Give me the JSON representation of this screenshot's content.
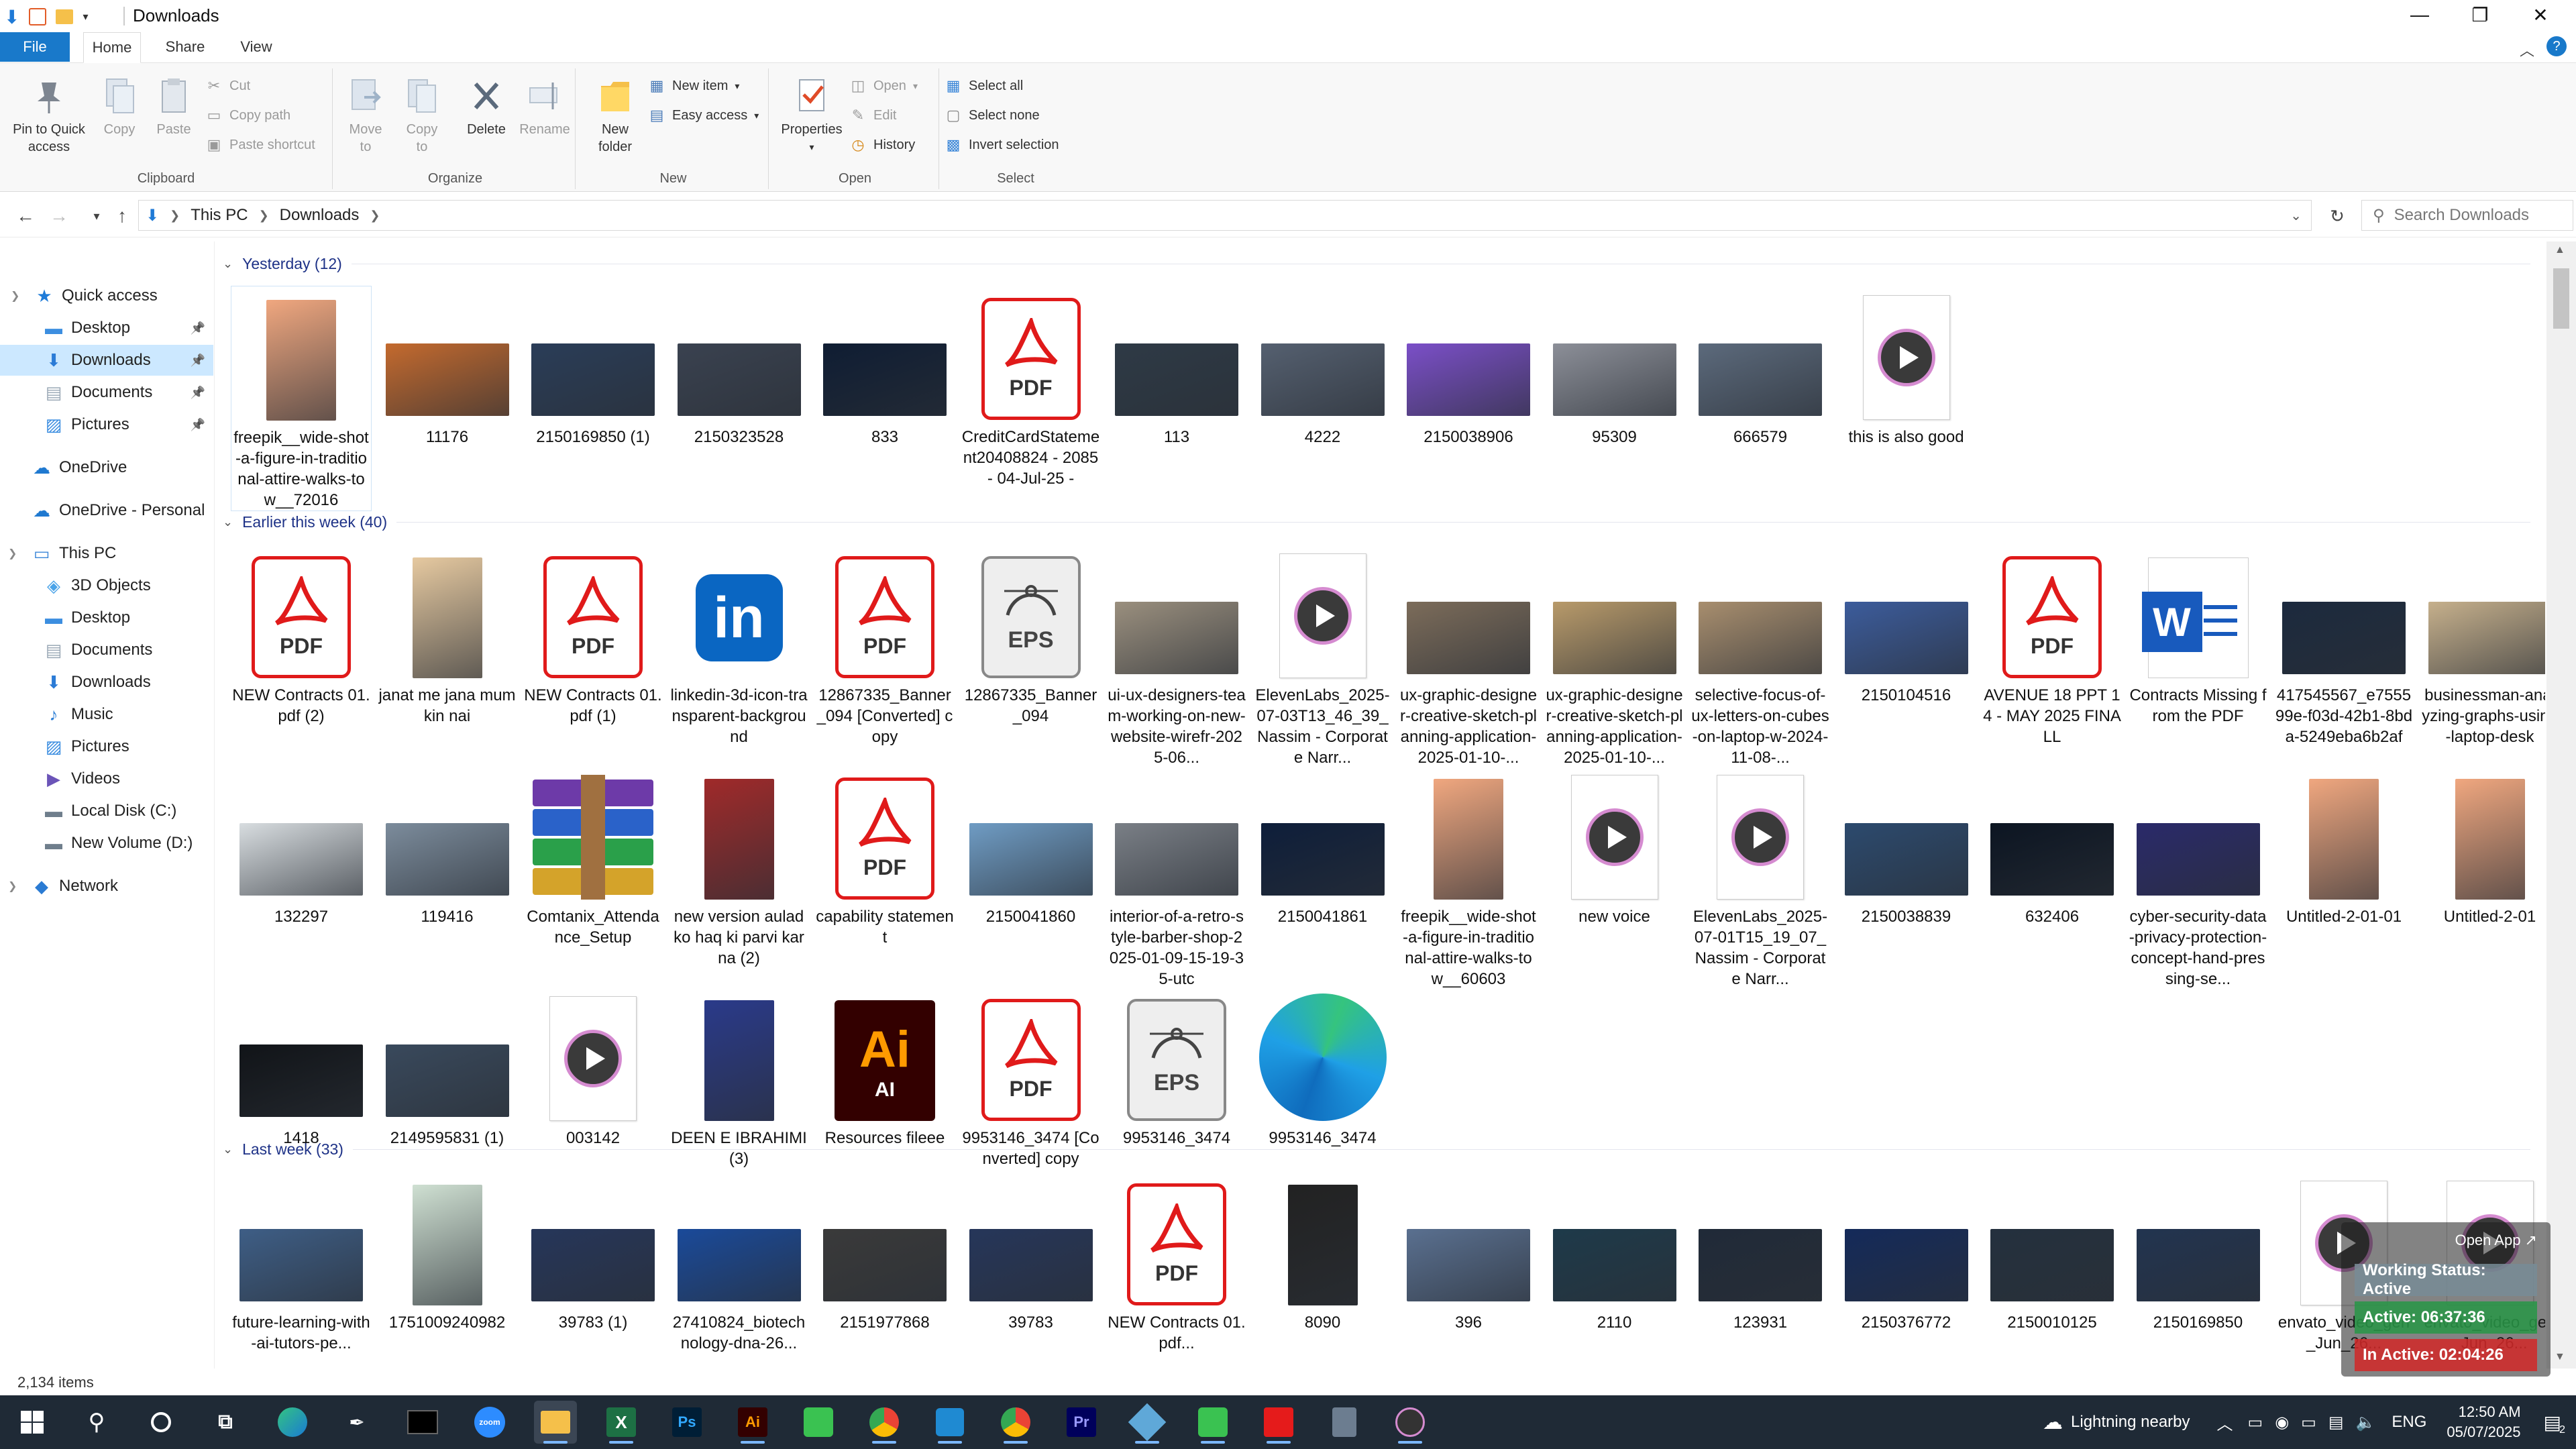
{
  "window": {
    "title": "Downloads"
  },
  "menu": {
    "file": "File",
    "home": "Home",
    "share": "Share",
    "view": "View"
  },
  "ribbon": {
    "clipboard": {
      "label": "Clipboard",
      "pin": "Pin to Quick access",
      "copy": "Copy",
      "paste": "Paste",
      "cut": "Cut",
      "copy_path": "Copy path",
      "paste_shortcut": "Paste shortcut"
    },
    "organize": {
      "label": "Organize",
      "move_to": "Move to",
      "copy_to": "Copy to",
      "delete": "Delete",
      "rename": "Rename"
    },
    "new": {
      "label": "New",
      "new_folder": "New folder",
      "new_item": "New item",
      "easy_access": "Easy access"
    },
    "open": {
      "label": "Open",
      "properties": "Properties",
      "open": "Open",
      "edit": "Edit",
      "history": "History"
    },
    "select": {
      "label": "Select",
      "select_all": "Select all",
      "select_none": "Select none",
      "invert": "Invert selection"
    }
  },
  "address": {
    "root": "This PC",
    "current": "Downloads",
    "search_placeholder": "Search Downloads"
  },
  "nav": [
    {
      "label": "Quick access",
      "icon": "star-icon",
      "color": "#1e7bd8"
    },
    {
      "label": "Desktop",
      "icon": "desktop-icon",
      "color": "#3c8ee0",
      "pinned": true
    },
    {
      "label": "Downloads",
      "icon": "download-icon",
      "color": "#2b7bd6",
      "pinned": true,
      "selected": true
    },
    {
      "label": "Documents",
      "icon": "documents-icon",
      "color": "#9aa8b6",
      "pinned": true
    },
    {
      "label": "Pictures",
      "icon": "pictures-icon",
      "color": "#3b8de0",
      "pinned": true
    },
    {
      "label": "OneDrive",
      "icon": "cloud-icon",
      "color": "#1f79d0"
    },
    {
      "label": "OneDrive - Personal",
      "icon": "cloud-icon",
      "color": "#1f79d0"
    },
    {
      "label": "This PC",
      "icon": "computer-icon",
      "color": "#3a86d8"
    },
    {
      "label": "3D Objects",
      "icon": "cube-icon",
      "color": "#4aa3e8"
    },
    {
      "label": "Desktop",
      "icon": "desktop-icon",
      "color": "#3c8ee0"
    },
    {
      "label": "Documents",
      "icon": "documents-icon",
      "color": "#9aa8b6"
    },
    {
      "label": "Downloads",
      "icon": "download-icon",
      "color": "#2b7bd6"
    },
    {
      "label": "Music",
      "icon": "music-icon",
      "color": "#2d7fd6"
    },
    {
      "label": "Pictures",
      "icon": "pictures-icon",
      "color": "#3b8de0"
    },
    {
      "label": "Videos",
      "icon": "videos-icon",
      "color": "#6b54b8"
    },
    {
      "label": "Local Disk (C:)",
      "icon": "disk-icon",
      "color": "#6f7e8c"
    },
    {
      "label": "New Volume (D:)",
      "icon": "disk-icon",
      "color": "#6f7e8c"
    },
    {
      "label": "Network",
      "icon": "network-icon",
      "color": "#2a7bd3"
    }
  ],
  "groups": [
    {
      "header": "Yesterday (12)",
      "items": [
        {
          "name": "freepik__wide-shot-a-figure-in-traditional-attire-walks-tow__72016",
          "kind": "photo",
          "color": "#f0a77f",
          "selected": true
        },
        {
          "name": "11176",
          "kind": "photo",
          "color": "#c46a2e"
        },
        {
          "name": "2150169850 (1)",
          "kind": "photo",
          "color": "#2a3d58"
        },
        {
          "name": "2150323528",
          "kind": "photo",
          "color": "#3a4250"
        },
        {
          "name": "833",
          "kind": "photo",
          "color": "#0f1d33"
        },
        {
          "name": "CreditCardStatement20408824 - 2085 - 04-Jul-25 -",
          "kind": "pdf"
        },
        {
          "name": "113",
          "kind": "photo",
          "color": "#2e3a46"
        },
        {
          "name": "4222",
          "kind": "photo",
          "color": "#556070"
        },
        {
          "name": "2150038906",
          "kind": "photo",
          "color": "#7b4fc8"
        },
        {
          "name": "95309",
          "kind": "photo",
          "color": "#8c8f98"
        },
        {
          "name": "666579",
          "kind": "photo",
          "color": "#5c6a7c"
        },
        {
          "name": "this is also good",
          "kind": "media"
        }
      ]
    },
    {
      "header": "Earlier this week (40)",
      "items": [
        {
          "name": "NEW Contracts 01.pdf (2)",
          "kind": "pdf"
        },
        {
          "name": "janat me jana mumkin nai",
          "kind": "photo",
          "color": "#e6c9a0"
        },
        {
          "name": "NEW Contracts 01.pdf (1)",
          "kind": "pdf"
        },
        {
          "name": "linkedin-3d-icon-transparent-background",
          "kind": "linkedin"
        },
        {
          "name": "12867335_Banner_094 [Converted] copy",
          "kind": "pdf"
        },
        {
          "name": "12867335_Banner_094",
          "kind": "eps"
        },
        {
          "name": "ui-ux-designers-team-working-on-new-website-wirefr-2025-06...",
          "kind": "photo",
          "color": "#9a8f7e"
        },
        {
          "name": "ElevenLabs_2025-07-03T13_46_39_Nassim - Corporate Narr...",
          "kind": "media"
        },
        {
          "name": "ux-graphic-designer-creative-sketch-planning-application-2025-01-10-...",
          "kind": "photo",
          "color": "#7c6c5a"
        },
        {
          "name": "ux-graphic-designer-creative-sketch-planning-application-2025-01-10-...",
          "kind": "photo",
          "color": "#b89a6a"
        },
        {
          "name": "selective-focus-of-ux-letters-on-cubes-on-laptop-w-2024-11-08-...",
          "kind": "photo",
          "color": "#a88e6e"
        },
        {
          "name": "2150104516",
          "kind": "photo",
          "color": "#3c5c9c"
        },
        {
          "name": "AVENUE 18 PPT 14 - MAY 2025 FINALL",
          "kind": "pdf"
        },
        {
          "name": "Contracts Missing from the PDF",
          "kind": "docx"
        },
        {
          "name": "417545567_e755599e-f03d-42b1-8bda-5249eba6b2af",
          "kind": "photo",
          "color": "#1c2a3e"
        },
        {
          "name": "businessman-analyzing-graphs-using-laptop-desk",
          "kind": "photo",
          "color": "#c6b08c"
        },
        {
          "name": "132297",
          "kind": "photo",
          "color": "#d8dde0"
        },
        {
          "name": "119416",
          "kind": "photo",
          "color": "#7c8c9c"
        },
        {
          "name": "Comtanix_Attendance_Setup",
          "kind": "rar"
        },
        {
          "name": "new version aulad ko haq ki parvi karna (2)",
          "kind": "photo",
          "color": "#a02a2a"
        },
        {
          "name": "capability statement",
          "kind": "pdf"
        },
        {
          "name": "2150041860",
          "kind": "photo",
          "color": "#6f9cc4"
        },
        {
          "name": "interior-of-a-retro-style-barber-shop-2025-01-09-15-19-35-utc",
          "kind": "photo",
          "color": "#7a7f86"
        },
        {
          "name": "2150041861",
          "kind": "photo",
          "color": "#0e1e3a"
        },
        {
          "name": "freepik__wide-shot-a-figure-in-traditional-attire-walks-tow__60603",
          "kind": "photo",
          "color": "#f0a77f"
        },
        {
          "name": "new voice",
          "kind": "media"
        },
        {
          "name": "ElevenLabs_2025-07-01T15_19_07_Nassim - Corporate Narr...",
          "kind": "media"
        },
        {
          "name": "2150038839",
          "kind": "photo",
          "color": "#2c4a6e"
        },
        {
          "name": "632406",
          "kind": "photo",
          "color": "#0c1522"
        },
        {
          "name": "cyber-security-data-privacy-protection-concept-hand-pressing-se...",
          "kind": "photo",
          "color": "#2a2a6a"
        },
        {
          "name": "Untitled-2-01-01",
          "kind": "photo",
          "color": "#f0a77f"
        },
        {
          "name": "Untitled-2-01",
          "kind": "photo",
          "color": "#f0a77f"
        },
        {
          "name": "1418",
          "kind": "photo",
          "color": "#111418"
        },
        {
          "name": "2149595831 (1)",
          "kind": "photo",
          "color": "#39495c"
        },
        {
          "name": "003142",
          "kind": "media"
        },
        {
          "name": "DEEN E IBRAHIMI (3)",
          "kind": "photo",
          "color": "#2a3a8a"
        },
        {
          "name": "Resources fileee",
          "kind": "ai"
        },
        {
          "name": "9953146_3474 [Converted] copy",
          "kind": "pdf"
        },
        {
          "name": "9953146_3474",
          "kind": "eps"
        },
        {
          "name": "9953146_3474",
          "kind": "edge"
        }
      ]
    },
    {
      "header": "Last week (33)",
      "items": [
        {
          "name": "future-learning-with-ai-tutors-pe...",
          "kind": "photo",
          "color": "#3e5e86"
        },
        {
          "name": "1751009240982",
          "kind": "photo",
          "color": "#cfe0d2"
        },
        {
          "name": "39783 (1)",
          "kind": "photo",
          "color": "#26365a"
        },
        {
          "name": "27410824_biotechnology-dna-26...",
          "kind": "photo",
          "color": "#1a4a9a"
        },
        {
          "name": "2151977868",
          "kind": "photo",
          "color": "#3a3a3a"
        },
        {
          "name": "39783",
          "kind": "photo",
          "color": "#26365a"
        },
        {
          "name": "NEW Contracts 01.pdf...",
          "kind": "pdf"
        },
        {
          "name": "8090",
          "kind": "photo",
          "color": "#222"
        },
        {
          "name": "396",
          "kind": "photo",
          "color": "#5a7090"
        },
        {
          "name": "2110",
          "kind": "photo",
          "color": "#1e3a4a"
        },
        {
          "name": "123931",
          "kind": "photo",
          "color": "#202a38"
        },
        {
          "name": "2150376772",
          "kind": "photo",
          "color": "#142a5a"
        },
        {
          "name": "2150010125",
          "kind": "photo",
          "color": "#24303e"
        },
        {
          "name": "2150169850",
          "kind": "photo",
          "color": "#223450"
        },
        {
          "name": "envato_video_gen_Jun_26...",
          "kind": "media"
        },
        {
          "name": "envato_video_gen_Jun_26...",
          "kind": "media"
        }
      ]
    }
  ],
  "status": {
    "items": "2,134 items"
  },
  "widget": {
    "open_app": "Open App ↗",
    "working_status": "Working Status: Active",
    "active": "Active: 06:37:36",
    "inactive": "In Active: 02:04:26"
  },
  "taskbar": {
    "weather": "Lightning nearby",
    "lang": "ENG",
    "time": "12:50 AM",
    "date": "05/07/2025",
    "notification_count": "2"
  }
}
